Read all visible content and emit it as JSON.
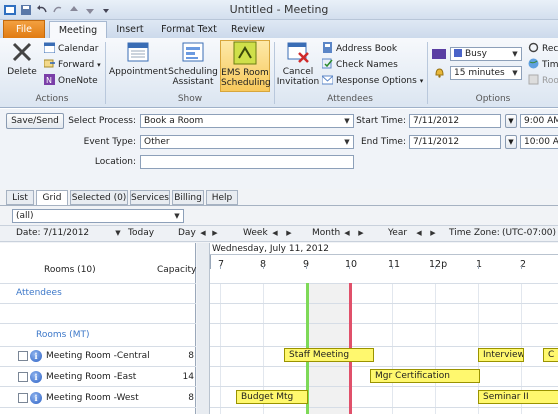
{
  "window": {
    "title": "Untitled - Meeting"
  },
  "ribbon_tabs": [
    "File",
    "Meeting",
    "Insert",
    "Format Text",
    "Review"
  ],
  "ribbon": {
    "actions": {
      "delete": "Delete",
      "calendar": "Calendar",
      "forward": "Forward",
      "onenote": "OneNote",
      "group": "Actions"
    },
    "show": {
      "appointment": "Appointment",
      "scheduling1": "Scheduling",
      "scheduling2": "Assistant",
      "ems1": "EMS Room",
      "ems2": "Scheduling",
      "group": "Show"
    },
    "attendees": {
      "cancel1": "Cancel",
      "cancel2": "Invitation",
      "address_book": "Address Book",
      "check_names": "Check Names",
      "response_options": "Response Options",
      "group": "Attendees"
    },
    "options": {
      "show_as": "Busy",
      "reminder": "15 minutes",
      "rec": "Rec",
      "tim": "Tim",
      "roo": "Roo",
      "group": "Options"
    }
  },
  "form": {
    "save_send": "Save/Send",
    "select_process_label": "Select Process:",
    "select_process_value": "Book a Room",
    "event_type_label": "Event Type:",
    "event_type_value": "Other",
    "location_label": "Location:",
    "location_value": "",
    "start_time_label": "Start Time:",
    "start_date": "7/11/2012",
    "start_time": "9:00 AM",
    "end_time_label": "End Time:",
    "end_date": "7/11/2012",
    "end_time": "10:00 AM"
  },
  "content_tabs": [
    "List",
    "Grid",
    "Selected (0)",
    "Services",
    "Billing",
    "Help"
  ],
  "filter": {
    "value": "(all)"
  },
  "nav": {
    "date_label": "Date:",
    "date_value": "7/11/2012",
    "today": "Today",
    "day": "Day",
    "week": "Week",
    "month": "Month",
    "year": "Year",
    "time_zone": "Time Zone:",
    "time_zone_value": "(UTC-07:00) M"
  },
  "grid": {
    "date_header": "Wednesday, July 11, 2012",
    "hours": [
      "7",
      "8",
      "9",
      "10",
      "11",
      "12p",
      "1",
      "2"
    ],
    "rooms_header": "Rooms (10)",
    "capacity_header": "Capacity",
    "attendees": "Attendees",
    "rooms_group": "Rooms (MT)",
    "rooms": [
      {
        "name": "Meeting Room -Central",
        "capacity": "8"
      },
      {
        "name": "Meeting Room -East",
        "capacity": "14"
      },
      {
        "name": "Meeting Room -West",
        "capacity": "8"
      }
    ],
    "events": [
      {
        "label": "Staff Meeting"
      },
      {
        "label": "Interview"
      },
      {
        "label": "C"
      },
      {
        "label": "Mgr Certification"
      },
      {
        "label": "Budget Mtg"
      },
      {
        "label": "Seminar II"
      }
    ]
  },
  "colors": {
    "file_tab": "#e07b12",
    "event_fill": "#fff86e",
    "start_line": "#7ed957",
    "end_line": "#e0506a"
  }
}
